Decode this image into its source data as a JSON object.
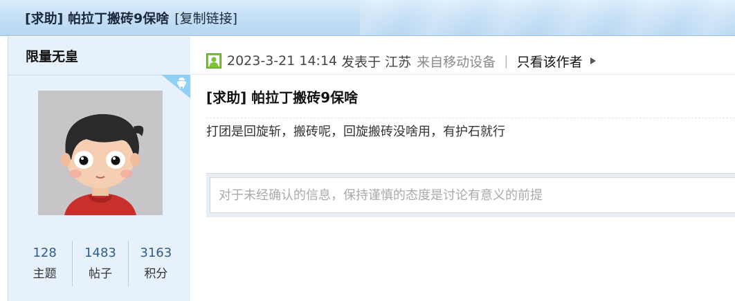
{
  "header": {
    "thread_title": "[求助] 帕拉丁搬砖9保啥",
    "copy_link": "[复制链接]"
  },
  "author": {
    "name": "限量无皇",
    "device_badge_icon": "android-icon",
    "stats": [
      {
        "value": "128",
        "label": "主题"
      },
      {
        "value": "1483",
        "label": "帖子"
      },
      {
        "value": "3163",
        "label": "积分"
      }
    ]
  },
  "post": {
    "online_icon": "user-online-icon",
    "date": "2023-3-21 14:14",
    "posted_in": "发表于",
    "location": "江苏",
    "device": "来自移动设备",
    "separator": "|",
    "only_author": "只看该作者",
    "title": "[求助] 帕拉丁搬砖9保啥",
    "body": "打团是回旋斩，搬砖呢，回旋搬砖没啥用，有护石就行"
  },
  "reply": {
    "placeholder": "对于未经确认的信息，保持谨慎的态度是讨论有意义的前提"
  },
  "colors": {
    "header_bg": "#c5e0f6",
    "sidebar_bg": "#e6f1fb",
    "stat_number": "#2e5c8a",
    "device_badge": "#8fd0f5"
  }
}
